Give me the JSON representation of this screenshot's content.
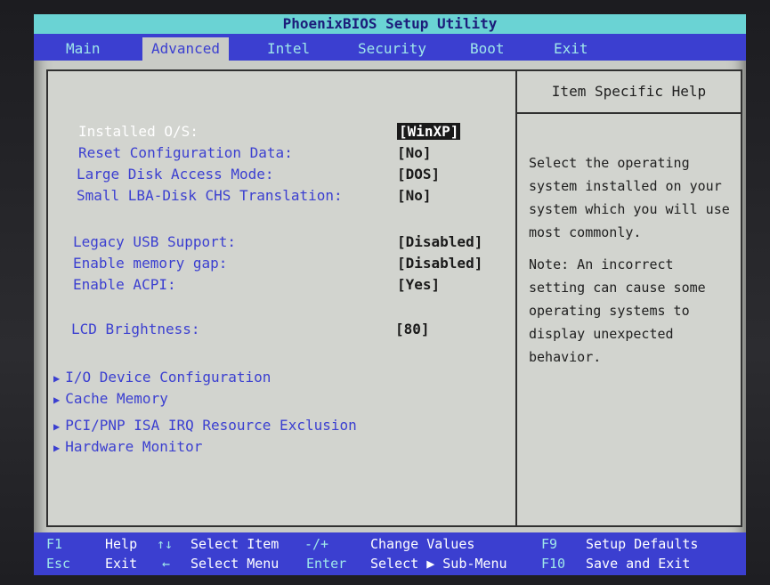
{
  "app_title": "PhoenixBIOS Setup Utility",
  "menu": [
    {
      "label": "Main",
      "active": false
    },
    {
      "label": "Advanced",
      "active": true
    },
    {
      "label": "Intel",
      "active": false
    },
    {
      "label": "Security",
      "active": false
    },
    {
      "label": "Boot",
      "active": false
    },
    {
      "label": "Exit",
      "active": false
    }
  ],
  "settings": [
    {
      "label": "Installed O/S:",
      "value": "[WinXP]",
      "selected": true
    },
    {
      "label": "Reset Configuration Data:",
      "value": "[No]"
    },
    {
      "label": "Large Disk Access Mode:",
      "value": "[DOS]"
    },
    {
      "label": "Small LBA-Disk CHS Translation:",
      "value": "[No]"
    },
    {
      "label": "Legacy USB Support:",
      "value": "[Disabled]"
    },
    {
      "label": "Enable memory gap:",
      "value": "[Disabled]"
    },
    {
      "label": "Enable ACPI:",
      "value": "[Yes]"
    },
    {
      "label": "LCD Brightness:",
      "value": "[80]"
    }
  ],
  "submenus": [
    {
      "label": "I/O Device Configuration"
    },
    {
      "label": "Cache Memory"
    },
    {
      "label": "PCI/PNP ISA IRQ Resource Exclusion"
    },
    {
      "label": "Hardware Monitor"
    }
  ],
  "help": {
    "title": "Item Specific Help",
    "paragraph1": "Select the operating system installed on your system which you will use most commonly.",
    "paragraph2": "Note: An incorrect setting can cause some operating systems to display unexpected behavior."
  },
  "footer": {
    "f1": "F1",
    "f1_desc": "Help",
    "arrows_ud": "↑↓",
    "arrows_ud_desc": "Select Item",
    "plusminus": "-/+",
    "plusminus_desc": "Change Values",
    "f9": "F9",
    "f9_desc": "Setup Defaults",
    "esc": "Esc",
    "esc_desc": "Exit",
    "arrows_lr": "←",
    "arrows_lr_desc": "Select Menu",
    "enter": "Enter",
    "enter_desc": "Select ▶ Sub-Menu",
    "f10": "F10",
    "f10_desc": "Save and Exit"
  }
}
